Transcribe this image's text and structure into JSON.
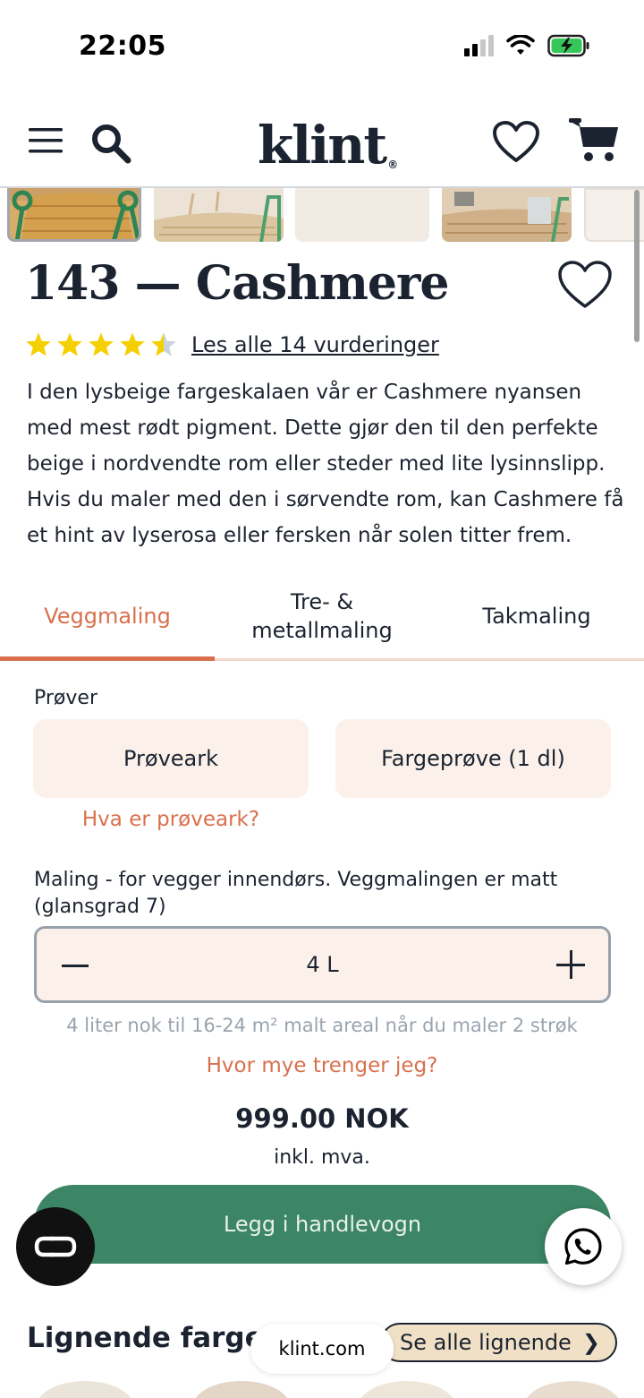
{
  "status_bar": {
    "time": "22:05"
  },
  "header": {
    "logo": "klint",
    "logo_mark": "®"
  },
  "product": {
    "title": "143 — Cashmere",
    "rating": 4.5,
    "reviews_link": "Les alle 14 vurderinger",
    "description": "I den lysbeige fargeskalaen vår er Cashmere nyansen med mest rødt pigment. Dette gjør den til den perfekte beige i nordvendte rom eller steder med lite lysinnslipp. Hvis du maler med den i sørvendte rom, kan Cashmere få et hint av lyserosa eller fersken når solen titter frem."
  },
  "tabs": [
    {
      "label": "Veggmaling",
      "active": true
    },
    {
      "label": "Tre- & metallmaling",
      "active": false
    },
    {
      "label": "Takmaling",
      "active": false
    }
  ],
  "samples": {
    "label": "Prøver",
    "buttons": [
      "Prøveark",
      "Fargeprøve (1 dl)"
    ],
    "info_link": "Hva er prøveark?"
  },
  "paint": {
    "label": "Maling - for vegger innendørs. Veggmalingen er matt (glansgrad 7)",
    "quantity": "4 L",
    "coverage": "4 liter nok til 16-24 m² malt areal når du maler 2 strøk",
    "help_link": "Hvor mye trenger jeg?",
    "price": "999.00 NOK",
    "vat": "inkl. mva.",
    "add_to_cart": "Legg i handlevogn"
  },
  "similar": {
    "title": "Lignende farger",
    "see_all": "Se alle lignende"
  },
  "browser": {
    "url": "klint.com"
  },
  "colors": {
    "accent": "#d9704d",
    "primary": "#3c8565",
    "ink": "#1c2330",
    "sample_bg": "#fbf1ea",
    "star": "#f5d000"
  }
}
